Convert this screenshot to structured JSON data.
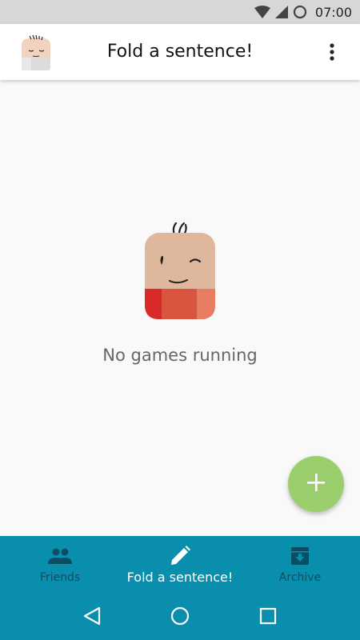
{
  "status_bar": {
    "time": "07:00",
    "icons": [
      "wifi-icon",
      "signal-icon",
      "data-saver-icon"
    ]
  },
  "app_bar": {
    "title": "Fold a sentence!",
    "avatar_icon": "user-avatar-face",
    "overflow_icon": "more-vert-icon"
  },
  "main": {
    "empty_message": "No games running",
    "illustration": "winking-face-character",
    "fab_icon": "plus-icon"
  },
  "bottom_nav": {
    "items": [
      {
        "label": "Friends",
        "icon": "people-icon",
        "active": false
      },
      {
        "label": "Fold a sentence!",
        "icon": "pencil-icon",
        "active": true
      },
      {
        "label": "Archive",
        "icon": "archive-icon",
        "active": false
      }
    ]
  },
  "system_nav": {
    "icons": [
      "back-icon",
      "home-icon",
      "recents-icon"
    ]
  },
  "colors": {
    "accent": "#0a8ead",
    "fab": "#9bcf6e",
    "inactive_nav": "#0b4e62",
    "background": "#f9f9f9"
  }
}
